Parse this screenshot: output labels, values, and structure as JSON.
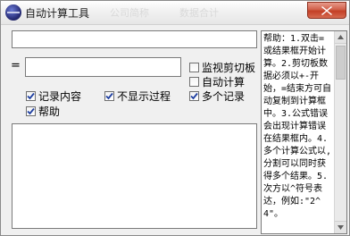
{
  "window": {
    "title": "自动计算工具",
    "ghost_text": [
      "公司简称",
      "数据合计"
    ]
  },
  "fields": {
    "equals_label": "=",
    "expression_value": "",
    "result_value": "",
    "notes_value": ""
  },
  "checkboxes": {
    "monitor_clipboard": {
      "label": "监视剪切板",
      "checked": false
    },
    "auto_calculate": {
      "label": "自动计算",
      "checked": false
    },
    "multiple_records": {
      "label": "多个记录",
      "checked": true
    },
    "record_content": {
      "label": "记录内容",
      "checked": true
    },
    "hide_process": {
      "label": "不显示过程",
      "checked": true
    },
    "help": {
      "label": "帮助",
      "checked": true
    }
  },
  "help_text": "帮助：1.双击=或结果框开始计算。2.剪切板数据必须以+-开始，=结束方可自动复制到计算框中。3.公式错误会出现计算错误在结果框内。4.多个计算公式以,分割可以同时获得多个结果。5.次方以^符号表达，例如:\"2^4\"。",
  "colors": {
    "window_bg": "#f0f0f0",
    "close_button": "#c94a32",
    "check_mark": "#1f3fa0"
  },
  "icons": {
    "app": "app-globe-icon",
    "close": "close-icon",
    "check": "checkmark-icon"
  }
}
